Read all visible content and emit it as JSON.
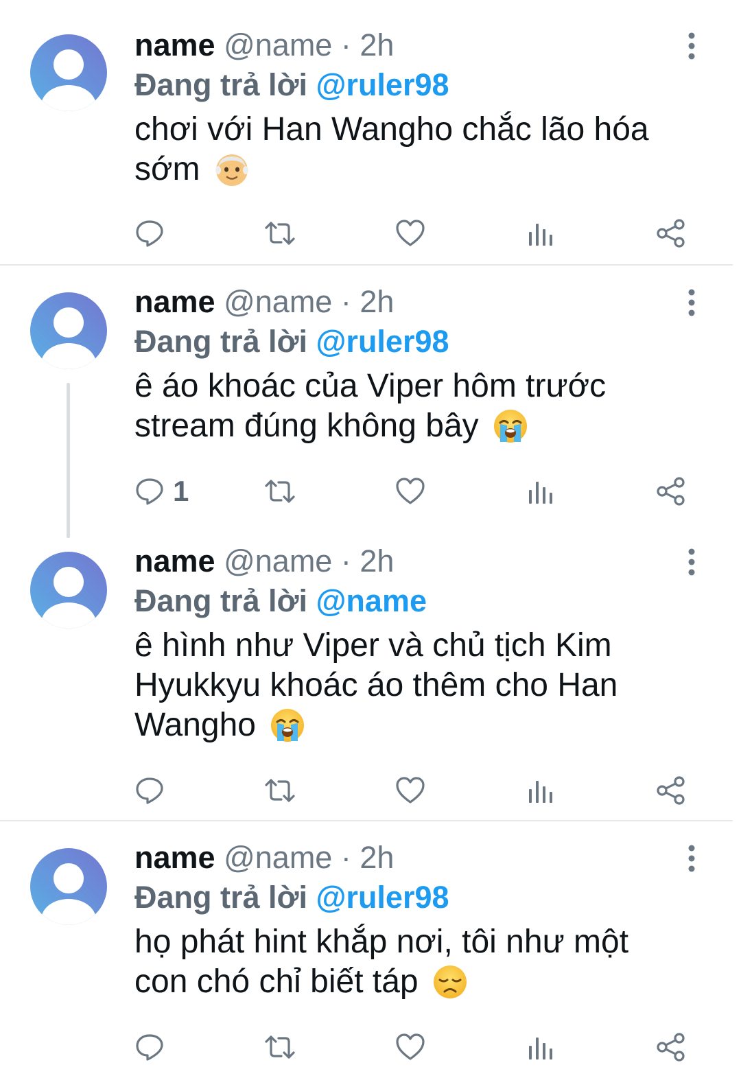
{
  "colors": {
    "accent": "#1d9bf0",
    "muted": "#6b7782",
    "icon": "#6b7782",
    "avatar_gradient": [
      "#6f86d6",
      "#5aa4e0"
    ]
  },
  "tweets": [
    {
      "display_name": "name",
      "handle": "@name",
      "separator": "·",
      "time": "2h",
      "reply_prefix": "Đang trả lời",
      "reply_to": "@ruler98",
      "text": "chơi với Han Wangho chắc lão hóa sớm",
      "emoji": "older-man-emoji",
      "reply_count": ""
    },
    {
      "display_name": "name",
      "handle": "@name",
      "separator": "·",
      "time": "2h",
      "reply_prefix": "Đang trả lời",
      "reply_to": "@ruler98",
      "text": "ê áo khoác của Viper hôm trước stream đúng không bây",
      "emoji": "loudly-crying-face-emoji",
      "reply_count": "1"
    },
    {
      "display_name": "name",
      "handle": "@name",
      "separator": "·",
      "time": "2h",
      "reply_prefix": "Đang trả lời",
      "reply_to": "@name",
      "text": "ê hình như Viper và chủ tịch Kim Hyukkyu khoác áo thêm cho Han Wangho",
      "emoji": "loudly-crying-face-emoji",
      "reply_count": ""
    },
    {
      "display_name": "name",
      "handle": "@name",
      "separator": "·",
      "time": "2h",
      "reply_prefix": "Đang trả lời",
      "reply_to": "@ruler98",
      "text": "họ phát hint khắp nơi, tôi như một con chó chỉ biết táp",
      "emoji": "disappointed-face-emoji",
      "reply_count": ""
    }
  ],
  "action_icons": [
    "reply-icon",
    "retweet-icon",
    "like-icon",
    "views-icon",
    "share-icon"
  ]
}
